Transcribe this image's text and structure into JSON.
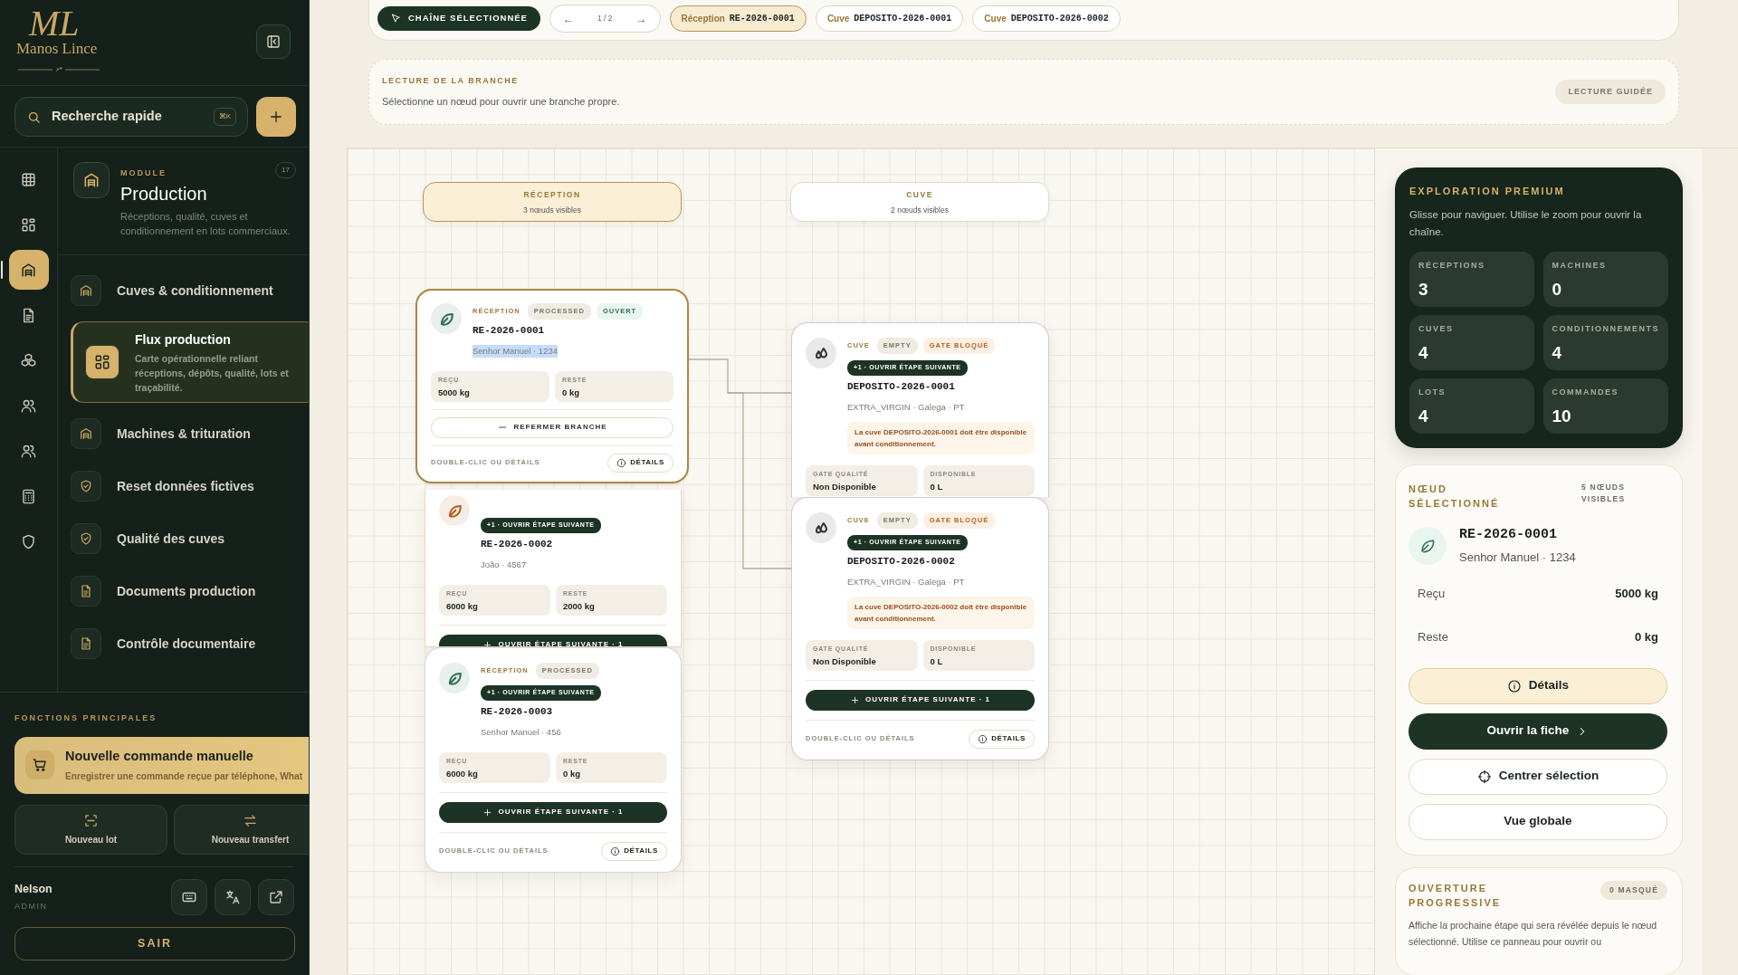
{
  "sidebar": {
    "logo": {
      "monogram": "ML",
      "name": "Manos Lince"
    },
    "search": {
      "placeholder": "Recherche rapide",
      "shortcut": "⌘K"
    },
    "rail": [
      {
        "selected": false
      },
      {
        "selected": false
      },
      {
        "selected": true
      },
      {
        "selected": false
      },
      {
        "selected": false
      },
      {
        "selected": false
      },
      {
        "selected": false
      },
      {
        "selected": false
      },
      {
        "selected": false
      }
    ],
    "module": {
      "eyebrow": "MODULE",
      "count": "17",
      "title": "Production",
      "description": "Réceptions, qualité, cuves et conditionnement en lots commerciaux."
    },
    "nav_items": [
      {
        "label": "Cuves & conditionnement",
        "selected": false
      },
      {
        "label": "Flux production",
        "description": "Carte opérationnelle reliant réceptions, dépôts, qualité, lots et traçabilité.",
        "selected": true
      },
      {
        "label": "Machines & trituration",
        "selected": false
      },
      {
        "label": "Reset données fictives",
        "selected": false
      },
      {
        "label": "Qualité des cuves",
        "selected": false
      },
      {
        "label": "Documents production",
        "selected": false
      },
      {
        "label": "Contrôle documentaire",
        "selected": false
      }
    ],
    "functions_title": "FONCTIONS PRINCIPALES",
    "primary_action": {
      "title": "Nouvelle commande manuelle",
      "description": "Enregistrer une commande reçue par téléphone, What"
    },
    "quick_actions": [
      "Nouveau lot",
      "Nouveau transfert"
    ],
    "user": {
      "name": "Nelson",
      "role": "ADMIN"
    },
    "logout": "SAIR"
  },
  "toolbar": {
    "selection_button": "CHAÎNE SÉLECTIONNÉE",
    "pager": {
      "prev": "←",
      "page": "1 / 2",
      "next": "→"
    },
    "chips": [
      {
        "type": "Réception",
        "id": "RE-2026-0001",
        "selected": true
      },
      {
        "type": "Cuve",
        "id": "DEPOSITO-2026-0001",
        "selected": false
      },
      {
        "type": "Cuve",
        "id": "DEPOSITO-2026-0002",
        "selected": false
      }
    ]
  },
  "branch_reading": {
    "title": "LECTURE DE LA BRANCHE",
    "text": "Sélectionne un nœud pour ouvrir une branche propre.",
    "button": "LECTURE GUIDÉE"
  },
  "canvas": {
    "columns": [
      {
        "title": "RÉCEPTION",
        "count": "3 nœuds visibles",
        "selected": true
      },
      {
        "title": "CUVE",
        "count": "2 nœuds visibles",
        "selected": false
      }
    ],
    "nodes": [
      {
        "kind": "reception",
        "color": "#2f6e52",
        "selected": true,
        "tags": [
          {
            "kind": "label",
            "text": "RÉCEPTION"
          },
          {
            "kind": "neutral",
            "text": "PROCESSED"
          },
          {
            "kind": "success",
            "text": "OUVERT"
          }
        ],
        "id": "RE-2026-0001",
        "subtitle": "Senhor Manuel · 1234",
        "highlighted": true,
        "metrics": [
          {
            "label": "REÇU",
            "value": "5000 kg"
          },
          {
            "label": "RESTE",
            "value": "0 kg"
          }
        ],
        "action": {
          "kind": "collapse",
          "label": "REFERMER BRANCHE"
        },
        "footer": {
          "hint": "DOUBLE-CLIC OU DÉTAILS",
          "button": "DÉTAILS"
        }
      },
      {
        "kind": "reception",
        "color": "#b45f22",
        "selected": false,
        "step_badge": "+1 · OUVRIR ÉTAPE SUIVANTE",
        "id": "RE-2026-0002",
        "subtitle": "João · 4567",
        "highlighted": false,
        "metrics": [
          {
            "label": "REÇU",
            "value": "6000 kg"
          },
          {
            "label": "RESTE",
            "value": "2000 kg"
          }
        ],
        "action": {
          "kind": "next",
          "label": "OUVRIR ÉTAPE SUIVANTE · 1"
        }
      },
      {
        "kind": "reception",
        "color": "#2f6e52",
        "selected": false,
        "tags": [
          {
            "kind": "label",
            "text": "RÉCEPTION"
          },
          {
            "kind": "neutral",
            "text": "PROCESSED"
          }
        ],
        "step_badge": "+1 · OUVRIR ÉTAPE SUIVANTE",
        "id": "RE-2026-0003",
        "subtitle": "Senhor Manuel · 456",
        "highlighted": false,
        "metrics": [
          {
            "label": "REÇU",
            "value": "6000 kg"
          },
          {
            "label": "RESTE",
            "value": "0 kg"
          }
        ],
        "action": {
          "kind": "next",
          "label": "OUVRIR ÉTAPE SUIVANTE · 1"
        },
        "footer": {
          "hint": "DOUBLE-CLIC OU DÉTAILS",
          "button": "DÉTAILS"
        }
      },
      {
        "kind": "cuve",
        "color": "#333333",
        "selected": false,
        "tags": [
          {
            "kind": "label",
            "text": "CUVE"
          },
          {
            "kind": "neutral",
            "text": "EMPTY"
          },
          {
            "kind": "warning",
            "text": "GATE BLOQUÉ"
          }
        ],
        "step_badge": "+1 · OUVRIR ÉTAPE SUIVANTE",
        "id": "DEPOSITO-2026-0001",
        "subtitle": "EXTRA_VIRGIN · Galega · PT",
        "highlighted": false,
        "warning": "La cuve DEPOSITO-2026-0001 doit être disponible avant conditionnement.",
        "metrics": [
          {
            "label": "GATE QUALITÉ",
            "value": "Non Disponible"
          },
          {
            "label": "DISPONIBLE",
            "value": "0 L"
          }
        ],
        "action": {
          "kind": "next"
        }
      },
      {
        "kind": "cuve",
        "color": "#333333",
        "selected": false,
        "tags": [
          {
            "kind": "label",
            "text": "CUVE"
          },
          {
            "kind": "neutral",
            "text": "EMPTY"
          },
          {
            "kind": "warning",
            "text": "GATE BLOQUÉ"
          }
        ],
        "step_badge": "+1 · OUVRIR ÉTAPE SUIVANTE",
        "id": "DEPOSITO-2026-0002",
        "subtitle": "EXTRA_VIRGIN · Galega · PT",
        "highlighted": false,
        "warning": "La cuve DEPOSITO-2026-0002 doit être disponible avant conditionnement.",
        "metrics": [
          {
            "label": "GATE QUALITÉ",
            "value": "Non Disponible"
          },
          {
            "label": "DISPONIBLE",
            "value": "0 L"
          }
        ],
        "action": {
          "kind": "next",
          "label": "OUVRIR ÉTAPE SUIVANTE · 1"
        },
        "footer": {
          "hint": "DOUBLE-CLIC OU DÉTAILS",
          "button": "DÉTAILS"
        }
      }
    ]
  },
  "right_panel": {
    "exploration": {
      "title": "EXPLORATION PREMIUM",
      "text": "Glisse pour naviguer. Utilise le zoom pour ouvrir la chaîne.",
      "stats": [
        {
          "label": "RÉCEPTIONS",
          "value": "3"
        },
        {
          "label": "MACHINES",
          "value": "0"
        },
        {
          "label": "CUVES",
          "value": "4"
        },
        {
          "label": "CONDITIONNEMENTS",
          "value": "4"
        },
        {
          "label": "LOTS",
          "value": "4"
        },
        {
          "label": "COMMANDES",
          "value": "10"
        }
      ]
    },
    "selected_node": {
      "title": "NŒUD SÉLECTIONNÉ",
      "visible_count": "5 NŒUDS VISIBLES",
      "id": "RE-2026-0001",
      "subtitle": "Senhor Manuel · 1234",
      "rows": [
        {
          "label": "Reçu",
          "value": "5000 kg"
        },
        {
          "label": "Reste",
          "value": "0 kg"
        }
      ],
      "buttons": [
        {
          "kind": "soft",
          "label": "Détails"
        },
        {
          "kind": "primary",
          "label": "Ouvrir la fiche"
        },
        {
          "kind": "outline",
          "label": "Centrer sélection"
        },
        {
          "kind": "outline",
          "label": "Vue globale"
        }
      ]
    },
    "progressive": {
      "title": "OUVERTURE PROGRESSIVE",
      "badge": "0 MASQUÉ",
      "text": "Affiche la prochaine étape qui sera révélée depuis le nœud sélectionné. Utilise ce panneau pour ouvrir ou"
    }
  }
}
